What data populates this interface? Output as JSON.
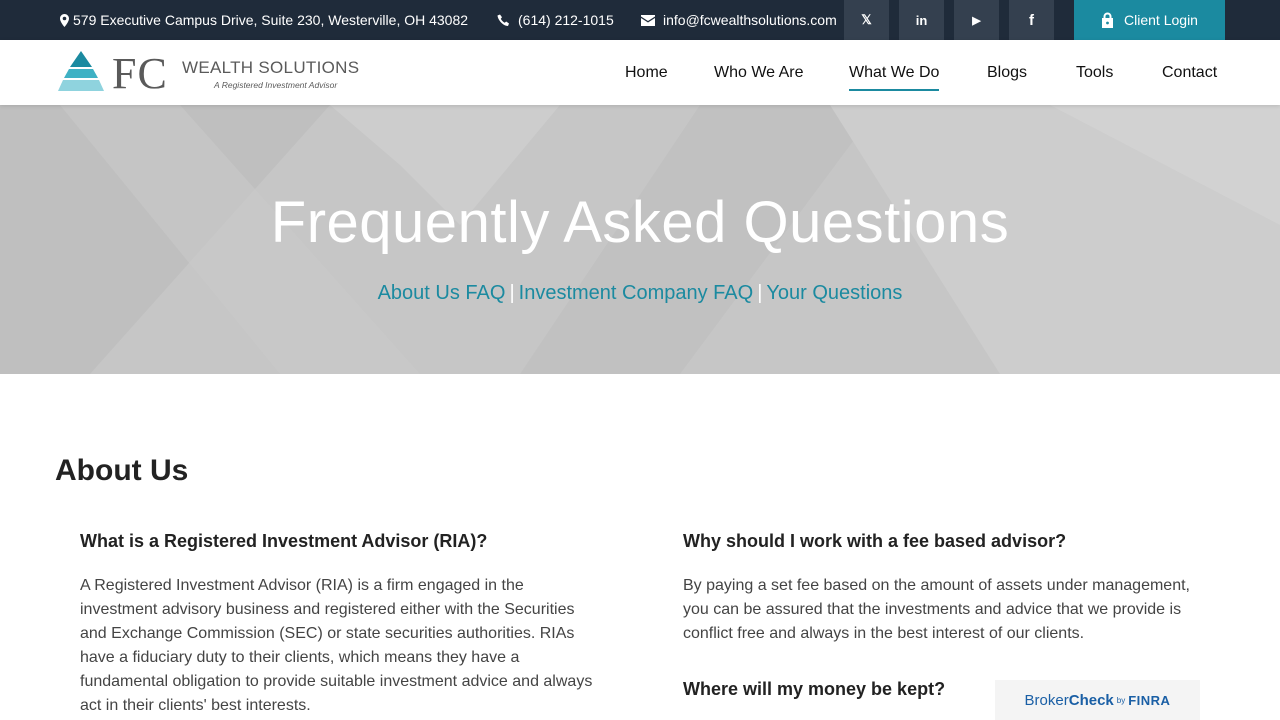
{
  "topbar": {
    "address": "579 Executive Campus Drive, Suite 230, Westerville, OH 43082",
    "phone": "(614) 212-1015",
    "email": "info@fcwealthsolutions.com",
    "social": [
      {
        "icon": "x-twitter-icon",
        "glyph": "𝕏"
      },
      {
        "icon": "linkedin-icon",
        "glyph": "in"
      },
      {
        "icon": "youtube-icon",
        "glyph": "▶"
      },
      {
        "icon": "facebook-icon",
        "glyph": "f"
      }
    ],
    "client_login": "Client Login"
  },
  "logo": {
    "letters": "FC",
    "name": "WEALTH SOLUTIONS",
    "tagline": "A Registered Investment Advisor"
  },
  "nav": {
    "items": [
      "Home",
      "Who We Are",
      "What We Do",
      "Blogs",
      "Tools",
      "Contact"
    ],
    "active": "What We Do"
  },
  "hero": {
    "title": "Frequently Asked Questions",
    "links": [
      "About Us FAQ",
      "Investment Company FAQ",
      "Your Questions"
    ],
    "separator": "|"
  },
  "section": {
    "title": "About Us"
  },
  "questions": [
    {
      "title": "What is a Registered Investment Advisor (RIA)?",
      "body": "A Registered Investment Advisor (RIA) is a firm engaged in the investment advisory business and registered either with the Securities and Exchange Commission (SEC) or state securities authorities. RIAs have a fiduciary duty to their clients, which means they have a fundamental obligation to provide suitable investment advice and always act in their clients' best interests."
    },
    {
      "title": "Why should I work with a fee based advisor?",
      "body": "By paying a set fee based on the amount of assets under management, you can be assured that the investments and advice that we provide is conflict free and always in the best interest of our clients."
    },
    {
      "title": "Where will my money be kept?",
      "body": ""
    }
  ],
  "brokercheck": {
    "broker": "Broker",
    "check": "Check",
    "by": "by",
    "finra": "FINRA"
  },
  "colors": {
    "topbar": "#1f2b3a",
    "accent": "#1b8aa0",
    "hero_bg": "#c8c8c8"
  }
}
